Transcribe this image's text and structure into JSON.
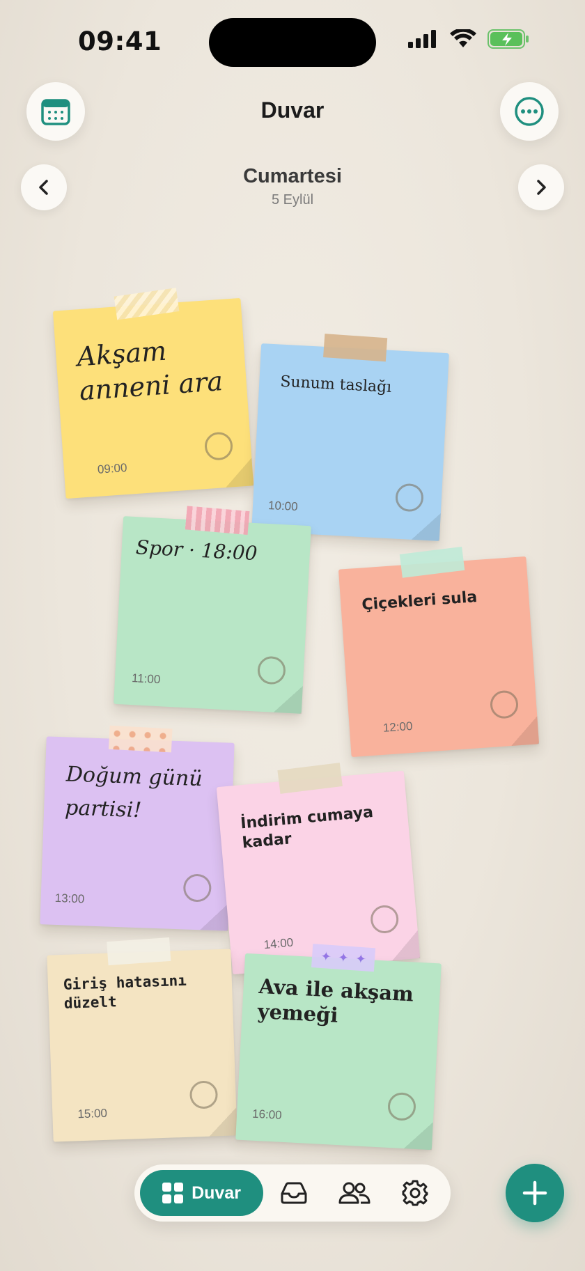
{
  "status": {
    "time": "09:41"
  },
  "header": {
    "title": "Duvar"
  },
  "day": {
    "name": "Cumartesi",
    "date": "5 Eylül"
  },
  "notes": [
    {
      "text": "Akşam anneni ara",
      "time": "09:00",
      "color": "#fde07a"
    },
    {
      "text": "Sunum taslağı",
      "time": "10:00",
      "color": "#a9d3f3"
    },
    {
      "text": "Spor · 18:00",
      "time": "11:00",
      "color": "#b8e6c6"
    },
    {
      "text": "Çiçekleri sula",
      "time": "12:00",
      "color": "#f9b29c"
    },
    {
      "text": "Doğum günü partisi!",
      "time": "13:00",
      "color": "#dcc1f2"
    },
    {
      "text": "İndirim cumaya kadar",
      "time": "14:00",
      "color": "#fbd3e6"
    },
    {
      "text": "Giriş hatasını düzelt",
      "time": "15:00",
      "color": "#f4e4c2"
    },
    {
      "text": "Ava ile akşam yemeği",
      "time": "16:00",
      "color": "#b8e6c6"
    }
  ],
  "nav": {
    "active_label": "Duvar"
  },
  "icons": {
    "calendar": "calendar-icon",
    "more": "more-icon",
    "prev": "chevron-left-icon",
    "next": "chevron-right-icon",
    "wall": "grid-icon",
    "inbox": "inbox-icon",
    "people": "people-icon",
    "settings": "gear-icon",
    "add": "plus-icon"
  },
  "accent": "#1f8f7f"
}
